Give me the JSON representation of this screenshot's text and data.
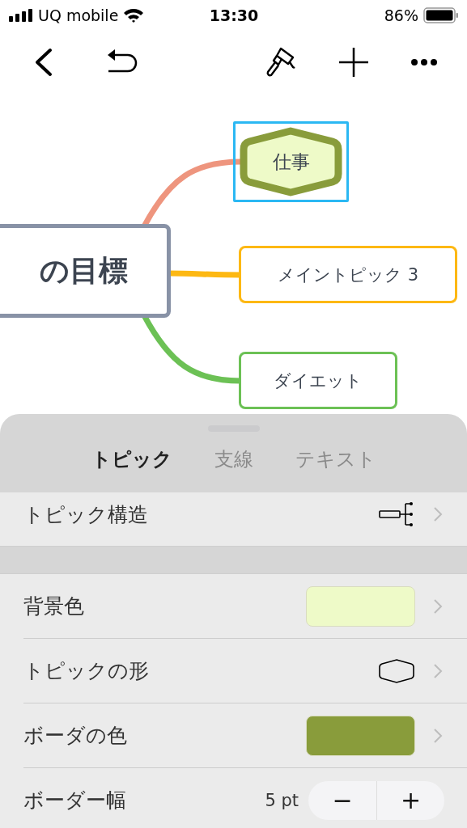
{
  "status_bar": {
    "carrier": "UQ mobile",
    "time": "13:30",
    "battery": "86%"
  },
  "map": {
    "central": {
      "text": "の目標"
    },
    "topics": [
      {
        "text": "仕事",
        "kind": "hexagon",
        "selected": true,
        "color": "#ee957e"
      },
      {
        "text": "メイントピック 3",
        "kind": "rect",
        "selected": false,
        "color": "#fdb813"
      },
      {
        "text": "ダイエット",
        "kind": "rect",
        "selected": false,
        "color": "#6cc155"
      }
    ]
  },
  "tabs": [
    {
      "label": "トピック",
      "selected": true
    },
    {
      "label": "支線",
      "selected": false
    },
    {
      "label": "テキスト",
      "selected": false
    }
  ],
  "sections": [
    [
      {
        "kind": "structure",
        "label": "トピック構造"
      }
    ],
    [
      {
        "kind": "color",
        "label": "背景色",
        "color": "#eefac8"
      },
      {
        "kind": "shape",
        "label": "トピックの形"
      },
      {
        "kind": "color",
        "label": "ボーダの色",
        "color": "#899c3b"
      },
      {
        "kind": "stepper",
        "label": "ボーダー幅",
        "value": "5 pt",
        "minus": "−",
        "plus": "+"
      }
    ]
  ]
}
